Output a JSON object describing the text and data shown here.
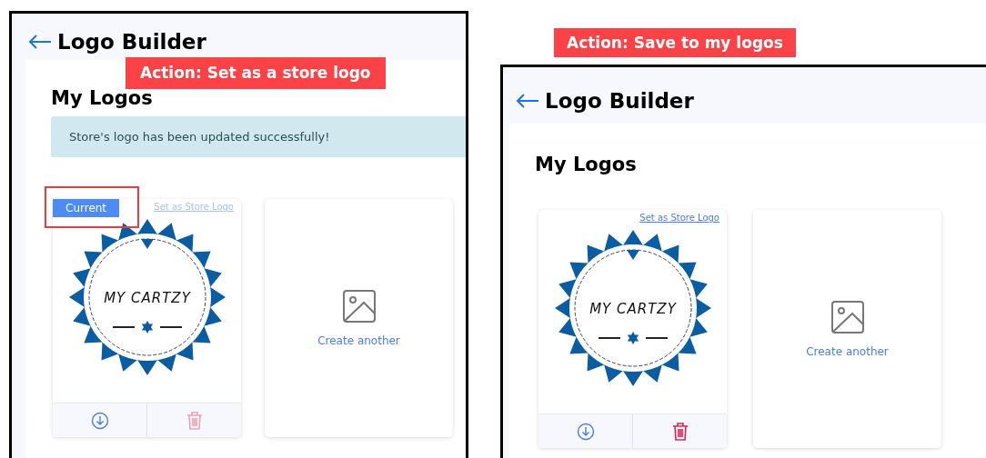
{
  "panels": [
    {
      "caption": "Action: Set as a store logo",
      "title": "Logo Builder",
      "heading": "My Logos",
      "alert": "Store's logo has been updated successfully!",
      "logos": [
        {
          "current": true,
          "badge": "Current",
          "set_link": "Set as Store Logo",
          "logo_text": "MY CARTZY",
          "delete_disabled": true
        }
      ],
      "create_label": "Create another"
    },
    {
      "caption": "Action: Save to my logos",
      "title": "Logo Builder",
      "heading": "My Logos",
      "logos": [
        {
          "current": false,
          "set_link": "Set as Store Logo",
          "logo_text": "MY CARTZY",
          "delete_disabled": false
        }
      ],
      "create_label": "Create another"
    }
  ]
}
